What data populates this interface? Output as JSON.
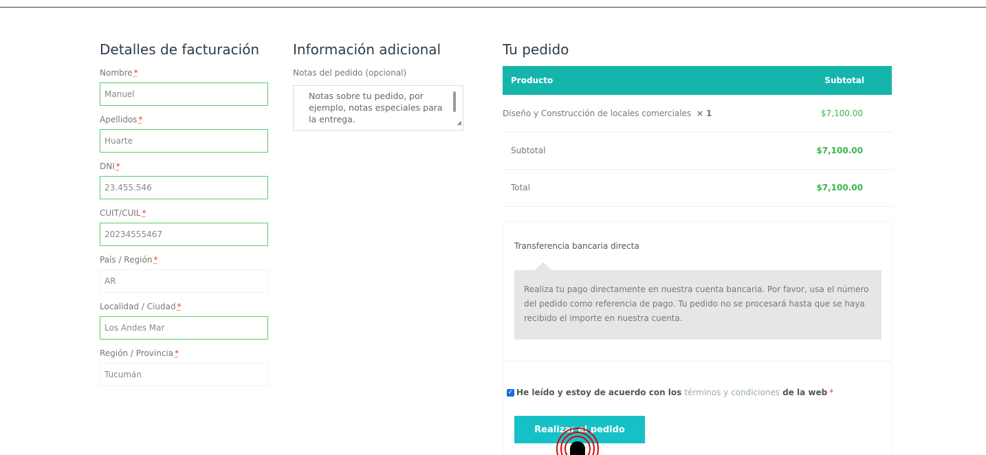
{
  "billing": {
    "title": "Detalles de facturación",
    "fields": [
      {
        "label": "Nombre",
        "required": "*",
        "value": "Manuel"
      },
      {
        "label": "Apellidos",
        "required": "*",
        "value": "Huarte"
      },
      {
        "label": "DNI",
        "required": "*",
        "value": "23.455.546"
      },
      {
        "label": "CUIT/CUIL",
        "required": "*",
        "value": "20234555467"
      },
      {
        "label": "País / Región",
        "required": "*",
        "value": "AR"
      },
      {
        "label": "Localidad / Ciudad",
        "required": "*",
        "value": "Los Andes Mar"
      },
      {
        "label": "Región / Provincia",
        "required": "*",
        "value": "Tucumán"
      }
    ]
  },
  "additional": {
    "title": "Información adicional",
    "notes_label": "Notas del pedido (opcional)",
    "notes_placeholder": "Notas sobre tu pedido, por ejemplo, notas especiales para la entrega."
  },
  "order": {
    "title": "Tu pedido",
    "header_product": "Producto",
    "header_subtotal": "Subtotal",
    "item_name": "Diseño y Construcción de locales comerciales",
    "item_qty": "× 1",
    "item_total": "$7,100.00",
    "subtotal_label": "Subtotal",
    "subtotal_value": "$7,100.00",
    "total_label": "Total",
    "total_value": "$7,100.00"
  },
  "payment": {
    "method_title": "Transferencia bancaria directa",
    "description": "Realiza tu pago directamente en nuestra cuenta bancaria. Por favor, usa el número del pedido como referencia de pago. Tu pedido no se procesará hasta que se haya recibido el importe en nuestra cuenta.",
    "terms_prefix": "He leído y estoy de acuerdo con los",
    "terms_link": "términos y condiciones",
    "terms_suffix": "de la web",
    "terms_required": "*",
    "place_order_label": "Realizar el pedido"
  },
  "colors": {
    "accent": "#15b5ab",
    "button": "#15c1c6",
    "price": "#3bb54a",
    "valid_border": "#5ec96e",
    "required": "#e2401c",
    "click_marker": "#e00000"
  }
}
